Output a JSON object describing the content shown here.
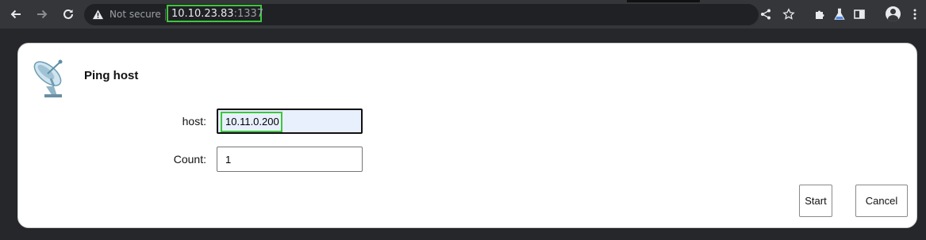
{
  "browser": {
    "security_label": "Not secure",
    "url_host": "10.10.23.83",
    "url_port": ":1337",
    "icons": [
      "back-icon",
      "forward-icon",
      "reload-icon",
      "warning-icon",
      "share-icon",
      "star-icon",
      "extensions-icon",
      "labs-icon",
      "sidepanel-icon",
      "avatar-icon",
      "menu-icon"
    ]
  },
  "dialog": {
    "title": "Ping host",
    "icon": "satellite-dish-icon",
    "fields": {
      "host_label": "host:",
      "host_value": "10.11.0.200",
      "count_label": "Count:",
      "count_value": "1"
    },
    "buttons": {
      "start": "Start",
      "cancel": "Cancel"
    }
  },
  "colors": {
    "highlight": "#3ec63e",
    "toolbar": "#35363a",
    "focused_field": "#e8f0fe"
  }
}
